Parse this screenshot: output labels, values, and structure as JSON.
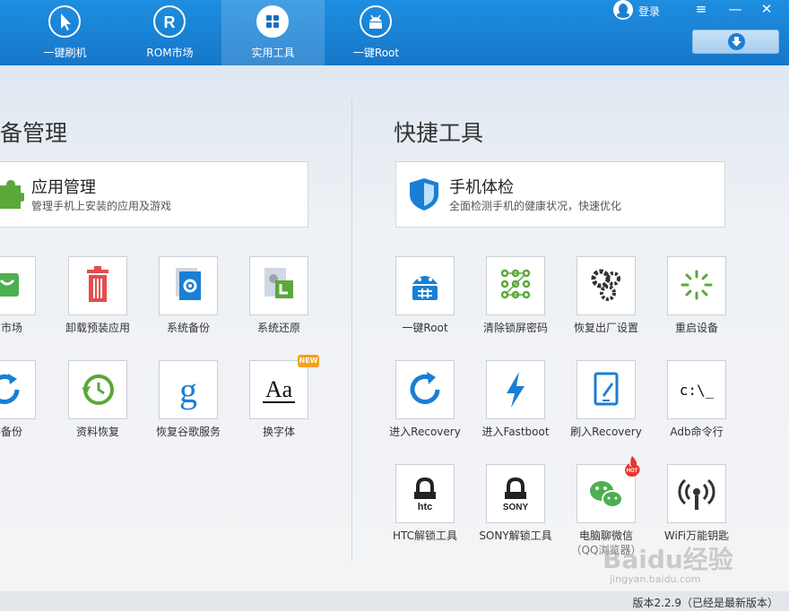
{
  "nav": {
    "items": [
      {
        "label": "一键刷机",
        "icon": "cursor-icon"
      },
      {
        "label": "ROM市场",
        "icon": "rom-icon"
      },
      {
        "label": "实用工具",
        "icon": "grid-icon"
      },
      {
        "label": "一键Root",
        "icon": "android-icon"
      }
    ],
    "active": 2
  },
  "header": {
    "login": "登录",
    "menu": "≡",
    "minimize": "—",
    "close": "✕"
  },
  "left": {
    "title": "备管理",
    "card": {
      "title": "应用管理",
      "desc": "管理手机上安装的应用及游戏"
    },
    "tools": [
      {
        "label": "用市场"
      },
      {
        "label": "卸载预装应用"
      },
      {
        "label": "系统备份"
      },
      {
        "label": "系统还原"
      },
      {
        "label": "料备份"
      },
      {
        "label": "资料恢复"
      },
      {
        "label": "恢复谷歌服务"
      },
      {
        "label": "换字体",
        "badge": "NEW",
        "glyph": "Aa"
      }
    ]
  },
  "right": {
    "title": "快捷工具",
    "card": {
      "title": "手机体检",
      "desc": "全面检测手机的健康状况，快速优化"
    },
    "tools": [
      {
        "label": "一键Root"
      },
      {
        "label": "清除锁屏密码"
      },
      {
        "label": "恢复出厂设置"
      },
      {
        "label": "重启设备"
      },
      {
        "label": "进入Recovery"
      },
      {
        "label": "进入Fastboot"
      },
      {
        "label": "刷入Recovery"
      },
      {
        "label": "Adb命令行",
        "glyph": "c:\\_"
      },
      {
        "label": "HTC解锁工具",
        "glyph": "htc"
      },
      {
        "label": "SONY解锁工具",
        "glyph": "SONY"
      },
      {
        "label": "电脑聊微信",
        "sub": "（QQ浏览器）",
        "badge": "HOT"
      },
      {
        "label": "WiFi万能钥匙"
      }
    ]
  },
  "footer": {
    "version": "版本2.2.9（已经是最新版本）"
  },
  "watermark": {
    "text": "Baidu经验",
    "sub": "jingyan.baidu.com"
  },
  "colors": {
    "header": "#1a82d6",
    "accent": "#1a7fd4",
    "green": "#4caf50",
    "red": "#e44c4c"
  }
}
